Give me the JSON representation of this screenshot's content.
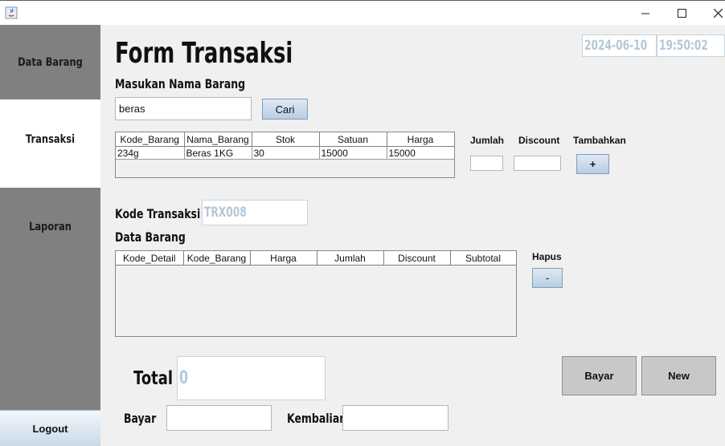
{
  "window": {
    "minimize_icon": "minimize-icon",
    "maximize_icon": "maximize-icon",
    "close_icon": "close-icon"
  },
  "sidebar": {
    "items": [
      {
        "label": "Data Barang",
        "active": false
      },
      {
        "label": "Transaksi",
        "active": true
      },
      {
        "label": "Laporan",
        "active": false
      }
    ],
    "logout_label": "Logout"
  },
  "header": {
    "title": "Form Transaksi",
    "date": "2024-06-10",
    "time": "19:50:02"
  },
  "search": {
    "label": "Masukan Nama Barang",
    "value": "beras",
    "button_label": "Cari"
  },
  "items_table": {
    "columns": [
      "Kode_Barang",
      "Nama_Barang",
      "Stok",
      "Satuan",
      "Harga"
    ],
    "rows": [
      [
        "234g",
        "Beras 1KG",
        "30",
        "15000",
        "15000"
      ]
    ]
  },
  "add_panel": {
    "jumlah_label": "Jumlah",
    "discount_label": "Discount",
    "tambahkan_label": "Tambahkan",
    "jumlah_value": "",
    "discount_value": "",
    "add_button_label": "+"
  },
  "transaction": {
    "kode_label": "Kode Transaksi",
    "kode_value": "TRX008",
    "data_barang_label": "Data Barang"
  },
  "detail_table": {
    "columns": [
      "Kode_Detail",
      "Kode_Barang",
      "Harga",
      "Jumlah",
      "Discount",
      "Subtotal"
    ],
    "rows": []
  },
  "hapus": {
    "label": "Hapus",
    "button_label": "-"
  },
  "totals": {
    "total_label": "Total",
    "total_value": "0",
    "bayar_label": "Bayar",
    "bayar_value": "",
    "kembalian_label": "Kembalian",
    "kembalian_value": ""
  },
  "actions": {
    "bayar_button": "Bayar",
    "new_button": "New"
  }
}
